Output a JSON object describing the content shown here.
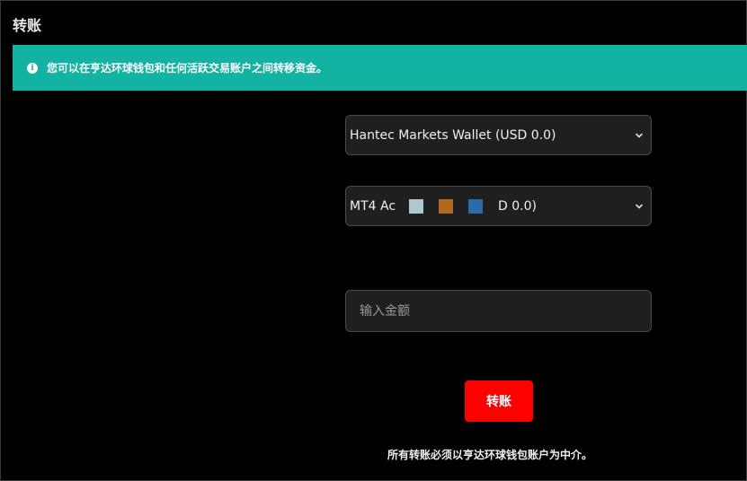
{
  "page": {
    "title": "转账"
  },
  "info_banner": {
    "icon": "info-circle-icon",
    "text": "您可以在亨达环球钱包和任何活跃交易账户之间转移资金。",
    "color": "#13b3a4"
  },
  "from_account": {
    "selected": "Hantec Markets Wallet (USD 0.0)"
  },
  "to_account": {
    "prefix": "MT4 Ac",
    "suffix": "D 0.0)",
    "swatch_colors": [
      "#aac9d3",
      "#b06a1e",
      "#2e6aa6"
    ]
  },
  "amount": {
    "placeholder": "输入金额",
    "value": ""
  },
  "actions": {
    "transfer_label": "转账",
    "transfer_color": "#ff0000"
  },
  "footer": {
    "note": "所有转账必须以亨达环球钱包账户为中介。"
  }
}
